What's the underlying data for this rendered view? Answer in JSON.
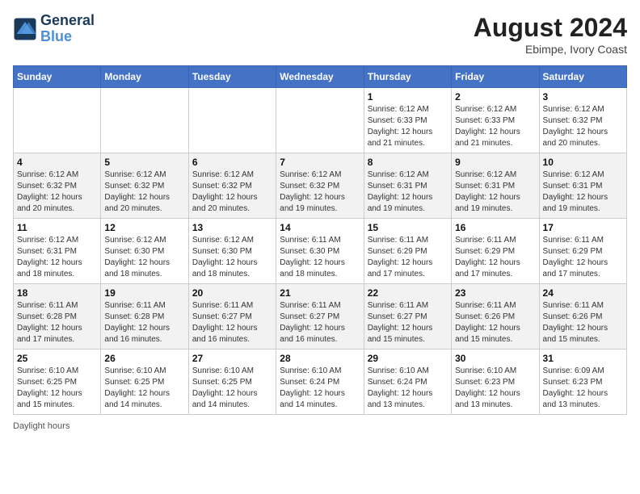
{
  "header": {
    "logo_line1": "General",
    "logo_line2": "Blue",
    "month_year": "August 2024",
    "location": "Ebimpe, Ivory Coast"
  },
  "weekdays": [
    "Sunday",
    "Monday",
    "Tuesday",
    "Wednesday",
    "Thursday",
    "Friday",
    "Saturday"
  ],
  "weeks": [
    [
      {
        "day": "",
        "info": ""
      },
      {
        "day": "",
        "info": ""
      },
      {
        "day": "",
        "info": ""
      },
      {
        "day": "",
        "info": ""
      },
      {
        "day": "1",
        "info": "Sunrise: 6:12 AM\nSunset: 6:33 PM\nDaylight: 12 hours\nand 21 minutes."
      },
      {
        "day": "2",
        "info": "Sunrise: 6:12 AM\nSunset: 6:33 PM\nDaylight: 12 hours\nand 21 minutes."
      },
      {
        "day": "3",
        "info": "Sunrise: 6:12 AM\nSunset: 6:32 PM\nDaylight: 12 hours\nand 20 minutes."
      }
    ],
    [
      {
        "day": "4",
        "info": "Sunrise: 6:12 AM\nSunset: 6:32 PM\nDaylight: 12 hours\nand 20 minutes."
      },
      {
        "day": "5",
        "info": "Sunrise: 6:12 AM\nSunset: 6:32 PM\nDaylight: 12 hours\nand 20 minutes."
      },
      {
        "day": "6",
        "info": "Sunrise: 6:12 AM\nSunset: 6:32 PM\nDaylight: 12 hours\nand 20 minutes."
      },
      {
        "day": "7",
        "info": "Sunrise: 6:12 AM\nSunset: 6:32 PM\nDaylight: 12 hours\nand 19 minutes."
      },
      {
        "day": "8",
        "info": "Sunrise: 6:12 AM\nSunset: 6:31 PM\nDaylight: 12 hours\nand 19 minutes."
      },
      {
        "day": "9",
        "info": "Sunrise: 6:12 AM\nSunset: 6:31 PM\nDaylight: 12 hours\nand 19 minutes."
      },
      {
        "day": "10",
        "info": "Sunrise: 6:12 AM\nSunset: 6:31 PM\nDaylight: 12 hours\nand 19 minutes."
      }
    ],
    [
      {
        "day": "11",
        "info": "Sunrise: 6:12 AM\nSunset: 6:31 PM\nDaylight: 12 hours\nand 18 minutes."
      },
      {
        "day": "12",
        "info": "Sunrise: 6:12 AM\nSunset: 6:30 PM\nDaylight: 12 hours\nand 18 minutes."
      },
      {
        "day": "13",
        "info": "Sunrise: 6:12 AM\nSunset: 6:30 PM\nDaylight: 12 hours\nand 18 minutes."
      },
      {
        "day": "14",
        "info": "Sunrise: 6:11 AM\nSunset: 6:30 PM\nDaylight: 12 hours\nand 18 minutes."
      },
      {
        "day": "15",
        "info": "Sunrise: 6:11 AM\nSunset: 6:29 PM\nDaylight: 12 hours\nand 17 minutes."
      },
      {
        "day": "16",
        "info": "Sunrise: 6:11 AM\nSunset: 6:29 PM\nDaylight: 12 hours\nand 17 minutes."
      },
      {
        "day": "17",
        "info": "Sunrise: 6:11 AM\nSunset: 6:29 PM\nDaylight: 12 hours\nand 17 minutes."
      }
    ],
    [
      {
        "day": "18",
        "info": "Sunrise: 6:11 AM\nSunset: 6:28 PM\nDaylight: 12 hours\nand 17 minutes."
      },
      {
        "day": "19",
        "info": "Sunrise: 6:11 AM\nSunset: 6:28 PM\nDaylight: 12 hours\nand 16 minutes."
      },
      {
        "day": "20",
        "info": "Sunrise: 6:11 AM\nSunset: 6:27 PM\nDaylight: 12 hours\nand 16 minutes."
      },
      {
        "day": "21",
        "info": "Sunrise: 6:11 AM\nSunset: 6:27 PM\nDaylight: 12 hours\nand 16 minutes."
      },
      {
        "day": "22",
        "info": "Sunrise: 6:11 AM\nSunset: 6:27 PM\nDaylight: 12 hours\nand 15 minutes."
      },
      {
        "day": "23",
        "info": "Sunrise: 6:11 AM\nSunset: 6:26 PM\nDaylight: 12 hours\nand 15 minutes."
      },
      {
        "day": "24",
        "info": "Sunrise: 6:11 AM\nSunset: 6:26 PM\nDaylight: 12 hours\nand 15 minutes."
      }
    ],
    [
      {
        "day": "25",
        "info": "Sunrise: 6:10 AM\nSunset: 6:25 PM\nDaylight: 12 hours\nand 15 minutes."
      },
      {
        "day": "26",
        "info": "Sunrise: 6:10 AM\nSunset: 6:25 PM\nDaylight: 12 hours\nand 14 minutes."
      },
      {
        "day": "27",
        "info": "Sunrise: 6:10 AM\nSunset: 6:25 PM\nDaylight: 12 hours\nand 14 minutes."
      },
      {
        "day": "28",
        "info": "Sunrise: 6:10 AM\nSunset: 6:24 PM\nDaylight: 12 hours\nand 14 minutes."
      },
      {
        "day": "29",
        "info": "Sunrise: 6:10 AM\nSunset: 6:24 PM\nDaylight: 12 hours\nand 13 minutes."
      },
      {
        "day": "30",
        "info": "Sunrise: 6:10 AM\nSunset: 6:23 PM\nDaylight: 12 hours\nand 13 minutes."
      },
      {
        "day": "31",
        "info": "Sunrise: 6:09 AM\nSunset: 6:23 PM\nDaylight: 12 hours\nand 13 minutes."
      }
    ]
  ],
  "footer": {
    "daylight_label": "Daylight hours"
  }
}
